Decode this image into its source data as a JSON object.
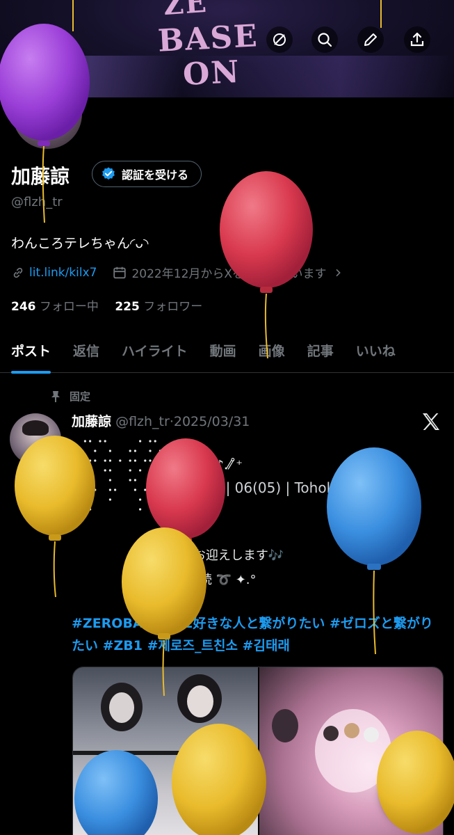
{
  "header": {
    "icons": [
      "back-icon",
      "hide-icon",
      "search-icon",
      "edit-icon",
      "share-icon"
    ]
  },
  "banner": {
    "art_lines": [
      "ZE",
      "BASE",
      "ON"
    ]
  },
  "profile": {
    "name": "加藤諒",
    "verify_label": "認証を受ける",
    "handle": "@flzh_tr",
    "bio": "わんころテレちゃん◜ᴗ◝",
    "link": "lit.link/kilx7",
    "joined": "2022年12月からXを利用しています",
    "following_count": "246",
    "following_label": "フォロー中",
    "followers_count": "225",
    "followers_label": "フォロワー"
  },
  "tabs": [
    {
      "label": "ポスト",
      "active": true
    },
    {
      "label": "返信",
      "active": false
    },
    {
      "label": "ハイライト",
      "active": false
    },
    {
      "label": "動画",
      "active": false
    },
    {
      "label": "画像",
      "active": false
    },
    {
      "label": "記事",
      "active": false
    },
    {
      "label": "いいね",
      "active": false
    }
  ],
  "post": {
    "pinned_label": "固定",
    "author_name": "加藤諒",
    "author_handle": "@flzh_tr",
    "separator": "·",
    "date": "2025/03/31",
    "name_line": "김태래 ♪.⁄⁄ ̊⁺",
    "info_line": "+81 | 06(05) | Tohoku",
    "line_3": "♡ or RT でお迎えします🎶",
    "line_4": "ALT必読 ➰ ✦.°",
    "hashtags": "#ZEROBASEONE好きな人と繋がりたい  #ゼロズと繋がりたい  #ZB1 #제로즈_트친소  #김태래"
  },
  "fab": {
    "icon": "plus-icon"
  },
  "colors": {
    "accent": "#1d9bf0",
    "background": "#000000",
    "muted_text": "#71767b",
    "balloon_purple": "#9b3fd8",
    "balloon_red": "#d9394e",
    "balloon_yellow": "#e9bb2c",
    "balloon_blue": "#3b8fe0"
  }
}
